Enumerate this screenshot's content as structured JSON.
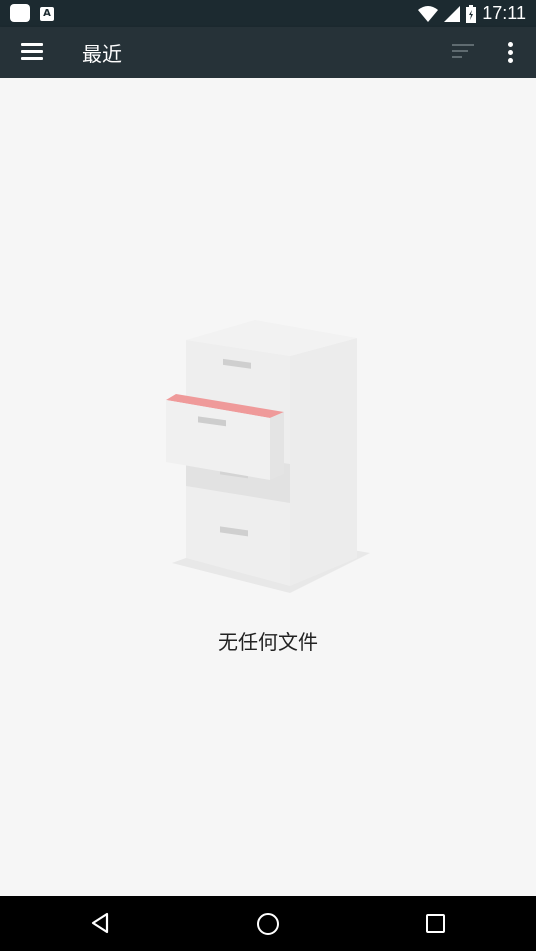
{
  "status_bar": {
    "time": "17:11",
    "icons": [
      "app-square-icon",
      "a-box-icon",
      "wifi-icon",
      "signal-icon",
      "battery-icon"
    ]
  },
  "app_bar": {
    "title": "最近",
    "icons": [
      "menu-icon",
      "sort-icon",
      "more-vert-icon"
    ]
  },
  "empty_state": {
    "illustration": "file-cabinet-icon",
    "message": "无任何文件",
    "accent_color": "#ef9a9a"
  },
  "nav_bar": {
    "icons": [
      "back-icon",
      "home-icon",
      "recents-icon"
    ]
  }
}
